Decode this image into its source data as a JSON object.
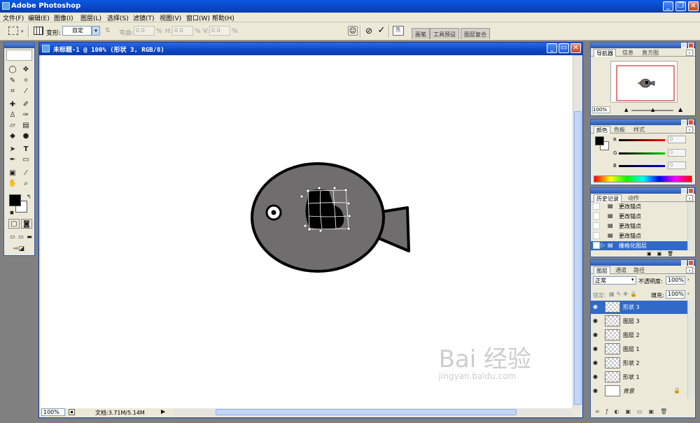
{
  "app": {
    "title": "Adobe Photoshop"
  },
  "menu": [
    "文件(F)",
    "编辑(E)",
    "图像(I)",
    "图层(L)",
    "选择(S)",
    "滤镜(T)",
    "视图(V)",
    "窗口(W)",
    "帮助(H)"
  ],
  "options": {
    "transform_label": "变形:",
    "transform_value": "自定",
    "bend_label": "弯曲:",
    "bend_value": "0.0",
    "h_label": "H:",
    "h_value": "0.0",
    "v_label": "V:",
    "v_value": "0.0",
    "percent": "%",
    "well_tabs": [
      "画笔",
      "工具预设",
      "图层复合"
    ]
  },
  "document": {
    "title": "未标题-1 @ 100% (形状 3, RGB/8)",
    "zoom": "100%",
    "doc_size": "文档:3.71M/5.14M"
  },
  "colors": {
    "bird_body": "#6f6d6e",
    "beak": "#f08a45",
    "title_blue": "#0b46c4",
    "selected_blue": "#3169c6",
    "foreground": "#000000",
    "background": "#ffffff"
  },
  "navigator": {
    "tabs": [
      "导航器",
      "信息",
      "直方图"
    ],
    "zoom": "100%"
  },
  "color_panel": {
    "tabs": [
      "颜色",
      "色板",
      "样式"
    ],
    "channels": [
      {
        "label": "R",
        "value": "0"
      },
      {
        "label": "G",
        "value": "0"
      },
      {
        "label": "B",
        "value": "0"
      }
    ]
  },
  "history": {
    "tabs": [
      "历史记录",
      "动作"
    ],
    "items": [
      "更改锚点",
      "更改锚点",
      "更改锚点",
      "更改锚点",
      "栅格化图层"
    ],
    "selected_index": 4
  },
  "layers": {
    "tabs": [
      "图层",
      "通道",
      "路径"
    ],
    "blend_mode": "正常",
    "opacity_label": "不透明度:",
    "opacity": "100%",
    "lock_label": "锁定:",
    "fill_label": "填充:",
    "fill": "100%",
    "items": [
      "形状 3",
      "图层 3",
      "图层 2",
      "图层 1",
      "形状 2",
      "形状 1",
      "背景"
    ],
    "selected_index": 0
  },
  "watermark": {
    "text": "Bai 经验",
    "subtext": "jingyan.baidu.com"
  }
}
